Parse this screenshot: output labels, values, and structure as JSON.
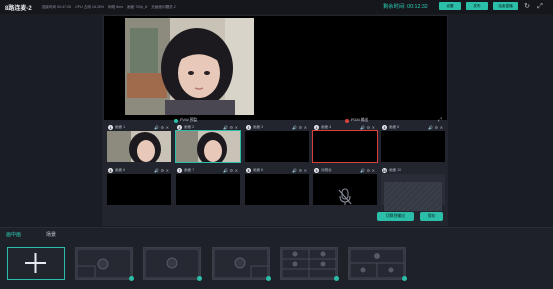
{
  "topbar": {
    "title": "8路连麦-2",
    "stats": [
      "连接时间 00:47:26",
      "CPU 占用 18.26%",
      "网络 6ms",
      "画面 720p_8",
      "无画面问题总 2"
    ],
    "remain_label": "剩余时间: 00:12:32",
    "buttons": [
      "设置",
      "发布",
      "结束直播"
    ],
    "icons": [
      "refresh-icon",
      "fullscreen-icon"
    ]
  },
  "preview": {
    "pvw_label": "PVW 预监",
    "pgm_label": "PGM 输出",
    "pvw_color": "#2bbfa9",
    "pgm_color": "#d8413b"
  },
  "cameras": [
    {
      "num": "1",
      "label": "画面 1",
      "state": "video"
    },
    {
      "num": "2",
      "label": "画面 2",
      "state": "pvw"
    },
    {
      "num": "3",
      "label": "画面 3",
      "state": "black"
    },
    {
      "num": "4",
      "label": "画面 4",
      "state": "pgm"
    },
    {
      "num": "5",
      "label": "画面 5",
      "state": "black"
    },
    {
      "num": "6",
      "label": "画面 6",
      "state": "black"
    },
    {
      "num": "7",
      "label": "画面 7",
      "state": "black"
    },
    {
      "num": "8",
      "label": "画面 8",
      "state": "black"
    },
    {
      "num": "9",
      "label": "远程台",
      "state": "mic"
    },
    {
      "num": "10",
      "label": "画面 10",
      "state": "empty"
    }
  ],
  "panel_buttons": {
    "switch_label": "切换到输出",
    "save_label": "保存"
  },
  "bottom": {
    "tabs": [
      "画中画",
      "场景"
    ]
  }
}
